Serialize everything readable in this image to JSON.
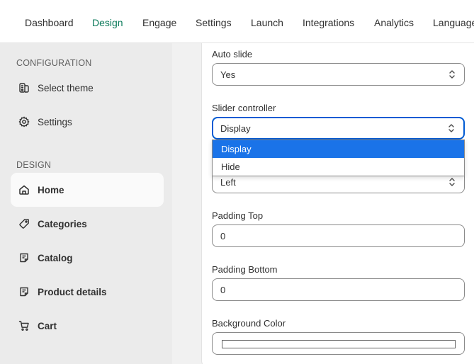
{
  "topnav": {
    "tabs": [
      {
        "label": "Dashboard"
      },
      {
        "label": "Design"
      },
      {
        "label": "Engage"
      },
      {
        "label": "Settings"
      },
      {
        "label": "Launch"
      },
      {
        "label": "Integrations"
      },
      {
        "label": "Analytics"
      },
      {
        "label": "Language"
      }
    ],
    "active_tab": "Design"
  },
  "sidebar": {
    "config_label": "CONFIGURATION",
    "config_items": [
      {
        "label": "Select theme",
        "icon": "theme-icon"
      },
      {
        "label": "Settings",
        "icon": "gear-icon"
      }
    ],
    "design_label": "DESIGN",
    "design_items": [
      {
        "label": "Home",
        "icon": "home-icon"
      },
      {
        "label": "Categories",
        "icon": "tag-icon"
      },
      {
        "label": "Catalog",
        "icon": "catalog-icon"
      },
      {
        "label": "Product details",
        "icon": "product-details-icon"
      },
      {
        "label": "Cart",
        "icon": "cart-icon"
      }
    ],
    "active_item": "Home"
  },
  "form": {
    "auto_slide": {
      "label": "Auto slide",
      "value": "Yes"
    },
    "slider_controller": {
      "label": "Slider controller",
      "value": "Display",
      "options": [
        "Display",
        "Hide"
      ]
    },
    "hidden_select": {
      "value": "Left"
    },
    "padding_top": {
      "label": "Padding Top",
      "value": "0"
    },
    "padding_bottom": {
      "label": "Padding Bottom",
      "value": "0"
    },
    "background_color": {
      "label": "Background Color",
      "value": "#ffffff"
    }
  },
  "colors": {
    "accent_green": "#0b7a5a",
    "focus_blue": "#005bd3",
    "option_highlight": "#1a73e8"
  }
}
